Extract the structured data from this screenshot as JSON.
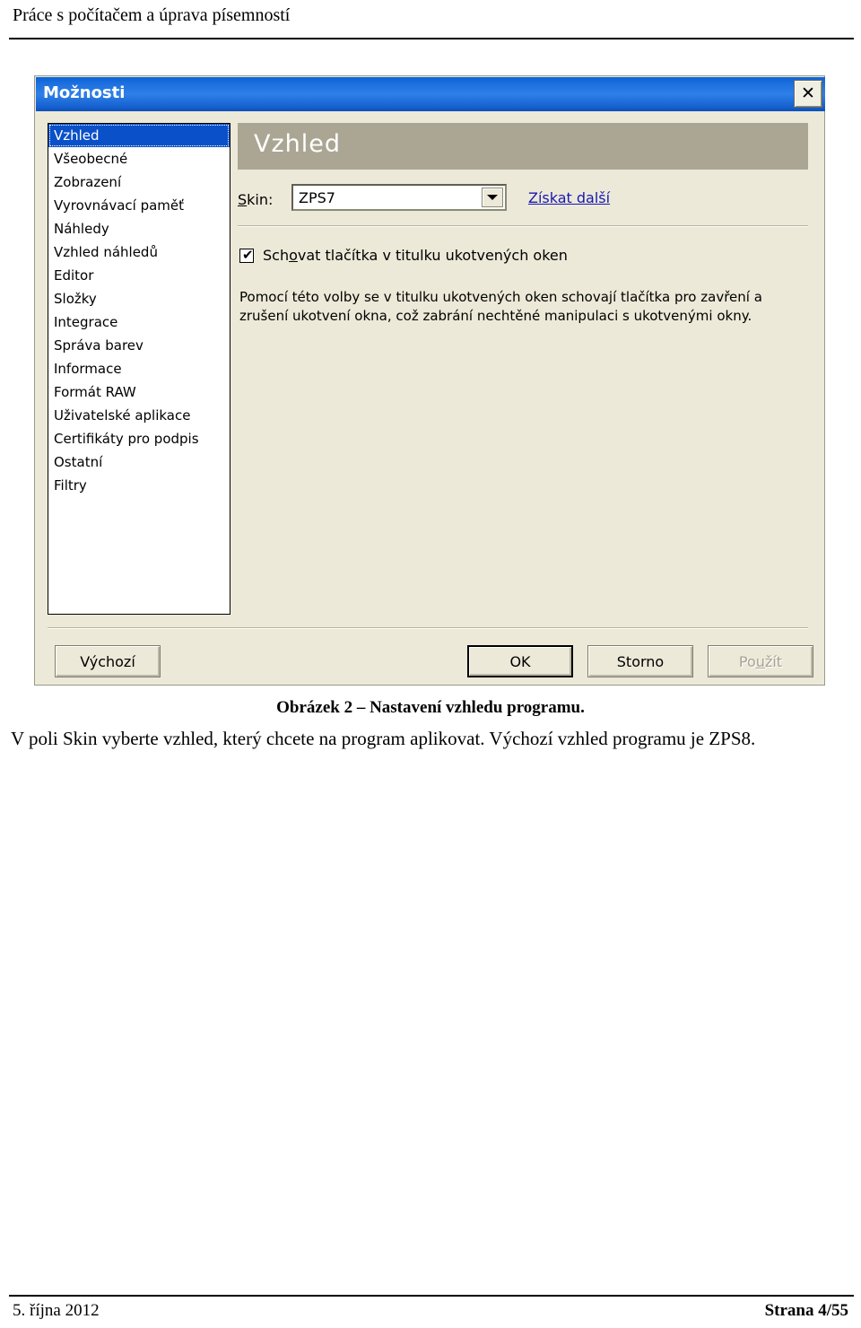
{
  "page": {
    "header_title": "Práce s počítačem a úprava písemností",
    "footer_date": "5. října 2012",
    "footer_page": "Strana 4/55"
  },
  "dialog": {
    "title": "Možnosti",
    "close_icon": "close-icon",
    "sidebar": {
      "items": [
        {
          "label": "Vzhled",
          "selected": true
        },
        {
          "label": "Všeobecné",
          "selected": false
        },
        {
          "label": "Zobrazení",
          "selected": false
        },
        {
          "label": "Vyrovnávací paměť",
          "selected": false
        },
        {
          "label": "Náhledy",
          "selected": false
        },
        {
          "label": "Vzhled náhledů",
          "selected": false
        },
        {
          "label": "Editor",
          "selected": false
        },
        {
          "label": "Složky",
          "selected": false
        },
        {
          "label": "Integrace",
          "selected": false
        },
        {
          "label": "Správa barev",
          "selected": false
        },
        {
          "label": "Informace",
          "selected": false
        },
        {
          "label": "Formát RAW",
          "selected": false
        },
        {
          "label": "Uživatelské aplikace",
          "selected": false
        },
        {
          "label": "Certifikáty pro podpis",
          "selected": false
        },
        {
          "label": "Ostatní",
          "selected": false
        },
        {
          "label": "Filtry",
          "selected": false
        }
      ]
    },
    "panel": {
      "heading": "Vzhled",
      "skin_label": "Skin:",
      "skin_value": "ZPS7",
      "skin_options": [
        "ZPS7"
      ],
      "get_more_link": "Získat další",
      "checkbox_label": "Schovat tlačítka v titulku ukotvených oken",
      "checkbox_checked": true,
      "checkbox_tick": "✔",
      "description": "Pomocí této volby se v titulku ukotvených oken schovají tlačítka pro zavření a zrušení ukotvení okna, což zabrání nechtěné manipulaci s ukotvenými okny."
    },
    "buttons": {
      "defaults": "Výchozí",
      "ok": "OK",
      "cancel": "Storno",
      "apply": "Použít",
      "apply_disabled": true
    },
    "colors": {
      "titlebar_blue": "#1C6FDE",
      "selection_blue": "#0A50C8",
      "panel_head": "#ABA694",
      "dialog_face": "#ECE9D8",
      "link": "#1818B0"
    }
  },
  "document": {
    "figure_caption": "Obrázek 2 – Nastavení vzhledu programu.",
    "paragraph": "V poli Skin vyberte vzhled, který chcete na program aplikovat. Výchozí vzhled programu je ZPS8."
  }
}
